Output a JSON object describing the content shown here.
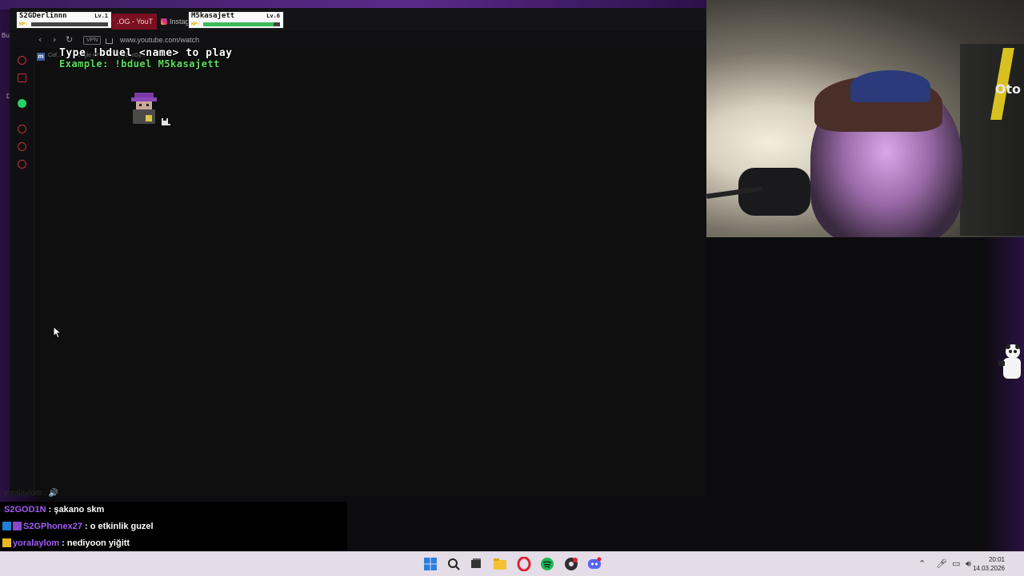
{
  "browser": {
    "tabs": [
      {
        "label": ".OG - YouT"
      },
      {
        "label": "Instag"
      }
    ],
    "address": {
      "vpn_label": "VPN",
      "url": "www.youtube.com/watch"
    },
    "bookmark_text": "Caf...  · · ·  Google Chr...  · · ·  (5)Z1zGy...",
    "left_edge_text": [
      "Bu",
      "D"
    ]
  },
  "game": {
    "instruction": "Type !bduel <name> to play",
    "example": "Example: !bduel M5kasajett",
    "players": [
      {
        "name": "S2GDerlinnn",
        "level": "Lv.1",
        "hp_label": "HP:",
        "hp_fraction": 0.0
      },
      {
        "name": "M5kasajett",
        "level": "Lv.6",
        "hp_label": "HP:",
        "hp_fraction": 0.92
      }
    ]
  },
  "webcam": {
    "background_text": "Oto"
  },
  "chat": {
    "ghost_line": "yoralaylom : 🔊",
    "messages": [
      {
        "user": "S2GOD1N",
        "user_color": "#a35ef5",
        "text": " : şakano skm",
        "badges": []
      },
      {
        "user": "S2GPhonex27",
        "user_color": "#a35ef5",
        "text": " : o etkinlik guzel",
        "badges": [
          "prime",
          "sub"
        ]
      },
      {
        "user": "yoralaylom",
        "user_color": "#a35ef5",
        "text": " : nediyoon yiğitt",
        "badges": [
          "crown"
        ]
      }
    ]
  },
  "taskbar": {
    "icons": [
      "windows-start-icon",
      "search-icon",
      "task-view-icon",
      "file-explorer-icon",
      "opera-icon",
      "spotify-icon",
      "obs-icon",
      "discord-icon"
    ],
    "time": "20:01",
    "date": "14.03.2026"
  },
  "colors": {
    "game_example_green": "#5dde5d",
    "hp_green": "#3cba5a",
    "taskbar": "#e4dde7",
    "chat_user": "#a35ef5"
  }
}
